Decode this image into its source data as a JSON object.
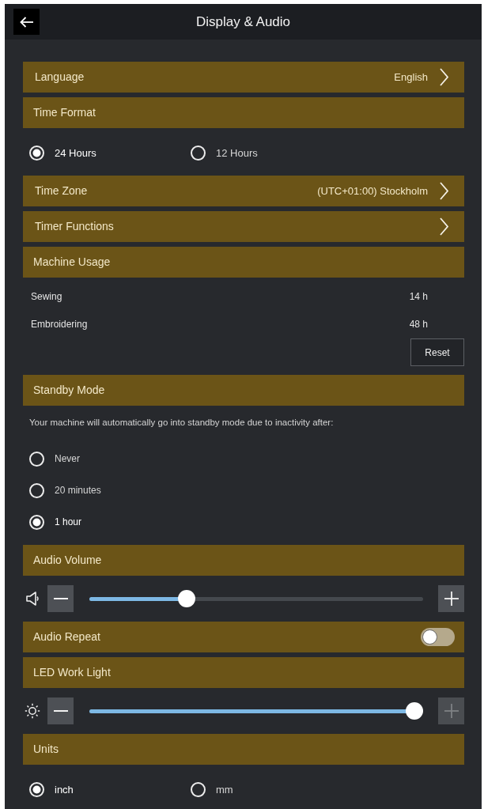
{
  "header": {
    "title": "Display & Audio"
  },
  "rows": [
    {
      "kind": "link",
      "label": "Language",
      "value": "English"
    },
    {
      "kind": "heading",
      "label": "Time Format"
    },
    {
      "kind": "choices",
      "options": [
        {
          "label": "24 Hours",
          "selected": true
        },
        {
          "label": "12 Hours",
          "selected": false
        }
      ]
    },
    {
      "kind": "link",
      "label": "Time Zone",
      "value": "(UTC+01:00) Stockholm"
    },
    {
      "kind": "link",
      "label": "Timer Functions"
    },
    {
      "kind": "heading",
      "label": "Machine Usage"
    },
    {
      "kind": "stat",
      "label": "Sewing",
      "value": "14 h"
    },
    {
      "kind": "stat",
      "label": "Embroidering",
      "value": "48 h"
    },
    {
      "kind": "action",
      "label": "Reset"
    },
    {
      "kind": "heading",
      "label": "Standby Mode"
    },
    {
      "kind": "note",
      "text": "Your machine will automatically go into standby mode due to inactivity after:"
    },
    {
      "kind": "options",
      "options": [
        {
          "label": "Never",
          "selected": false
        },
        {
          "label": "20 minutes",
          "selected": false
        },
        {
          "label": "1 hour",
          "selected": true
        }
      ]
    },
    {
      "kind": "heading",
      "label": "Audio Volume"
    },
    {
      "kind": "volume",
      "level": 0.28,
      "minus": {
        "disabled": false
      },
      "plus": {
        "disabled": false
      }
    },
    {
      "kind": "toggle",
      "label": "Audio Repeat",
      "on": false
    },
    {
      "kind": "heading",
      "label": "LED Work Light"
    },
    {
      "kind": "light",
      "level": 1,
      "minus": {
        "disabled": false
      },
      "plus": {
        "disabled": true
      }
    },
    {
      "kind": "heading",
      "label": "Units"
    },
    {
      "kind": "choices",
      "options": [
        {
          "label": "inch",
          "selected": true
        },
        {
          "label": "mm",
          "selected": false
        }
      ]
    }
  ]
}
